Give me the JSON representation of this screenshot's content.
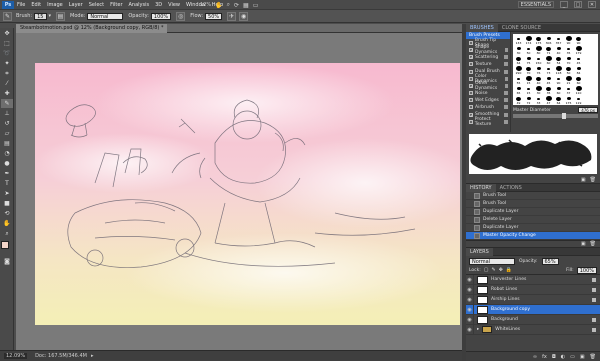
{
  "app": {
    "logo": "Ps",
    "workspace": "ESSENTIALS",
    "zoom": "12%",
    "winmin": "_",
    "winmax": "□",
    "winclose": "✕"
  },
  "menu": [
    "File",
    "Edit",
    "Image",
    "Layer",
    "Select",
    "Filter",
    "Analysis",
    "3D",
    "View",
    "Window",
    "Help"
  ],
  "options": {
    "brush_label": "Brush:",
    "brush_size": "15",
    "mode_label": "Mode:",
    "mode_value": "Normal",
    "opacity_label": "Opacity:",
    "opacity_value": "100%",
    "flow_label": "Flow:",
    "flow_value": "50%"
  },
  "document": {
    "tab_title": "Steambotmotion.psd @ 12% (Background copy, RGB/8) *"
  },
  "status": {
    "zoom": "12.09%",
    "doc_info": "Doc: 167.5M/346.4M"
  },
  "brushes": {
    "tabs": [
      "BRUSHES",
      "CLONE SOURCE"
    ],
    "items": [
      {
        "label": "Brush Presets",
        "sel": true
      },
      {
        "label": "Brush Tip Shape"
      },
      {
        "label": "Shape Dynamics",
        "checked": true
      },
      {
        "label": "Scattering",
        "checked": true
      },
      {
        "label": "Texture"
      },
      {
        "label": "Dual Brush"
      },
      {
        "label": "Color Dynamics"
      },
      {
        "label": "Other Dynamics",
        "checked": true
      },
      {
        "label": "Noise"
      },
      {
        "label": "Wet Edges"
      },
      {
        "label": "Airbrush"
      },
      {
        "label": "Smoothing",
        "checked": true
      },
      {
        "label": "Protect Texture"
      }
    ],
    "thumb_numbers": [
      "133",
      "174",
      "175",
      "306",
      "357",
      "90",
      "90",
      "30",
      "50",
      "80",
      "71",
      "40",
      "35",
      "179",
      "64",
      "75",
      "150",
      "60",
      "54",
      "70",
      "45",
      "290",
      "70",
      "76",
      "73",
      "118",
      "50",
      "84",
      "55",
      "15",
      "40",
      "45",
      "90",
      "21",
      "60",
      "65",
      "15",
      "30",
      "35",
      "60",
      "37",
      "110",
      "49",
      "72",
      "33",
      "47",
      "64",
      "175",
      "119"
    ],
    "master_diameter_label": "Master Diameter",
    "master_diameter_value": "476 px"
  },
  "history": {
    "tabs": [
      "HISTORY",
      "ACTIONS"
    ],
    "items": [
      {
        "label": "Brush Tool"
      },
      {
        "label": "Brush Tool"
      },
      {
        "label": "Duplicate Layer"
      },
      {
        "label": "Delete Layer"
      },
      {
        "label": "Duplicate Layer"
      },
      {
        "label": "Master Opacity Change",
        "sel": true
      }
    ]
  },
  "layers": {
    "tab": "LAYERS",
    "blend_mode": "Normal",
    "opacity_label": "Opacity:",
    "opacity_value": "65%",
    "lock_label": "Lock:",
    "fill_label": "Fill:",
    "fill_value": "100%",
    "items": [
      {
        "label": "Harvester Lines",
        "lock": true
      },
      {
        "label": "Robot Lines",
        "lock": true
      },
      {
        "label": "Airship Lines",
        "lock": true
      },
      {
        "label": "Background copy",
        "sel": true
      },
      {
        "label": "Background",
        "lock": true
      },
      {
        "label": "WhiteLines",
        "group": true,
        "lock": true
      }
    ]
  },
  "colors": {
    "accent": "#2f6fcf",
    "sky_top": "#f7bdd0",
    "sky_bottom": "#f4f0b8"
  }
}
